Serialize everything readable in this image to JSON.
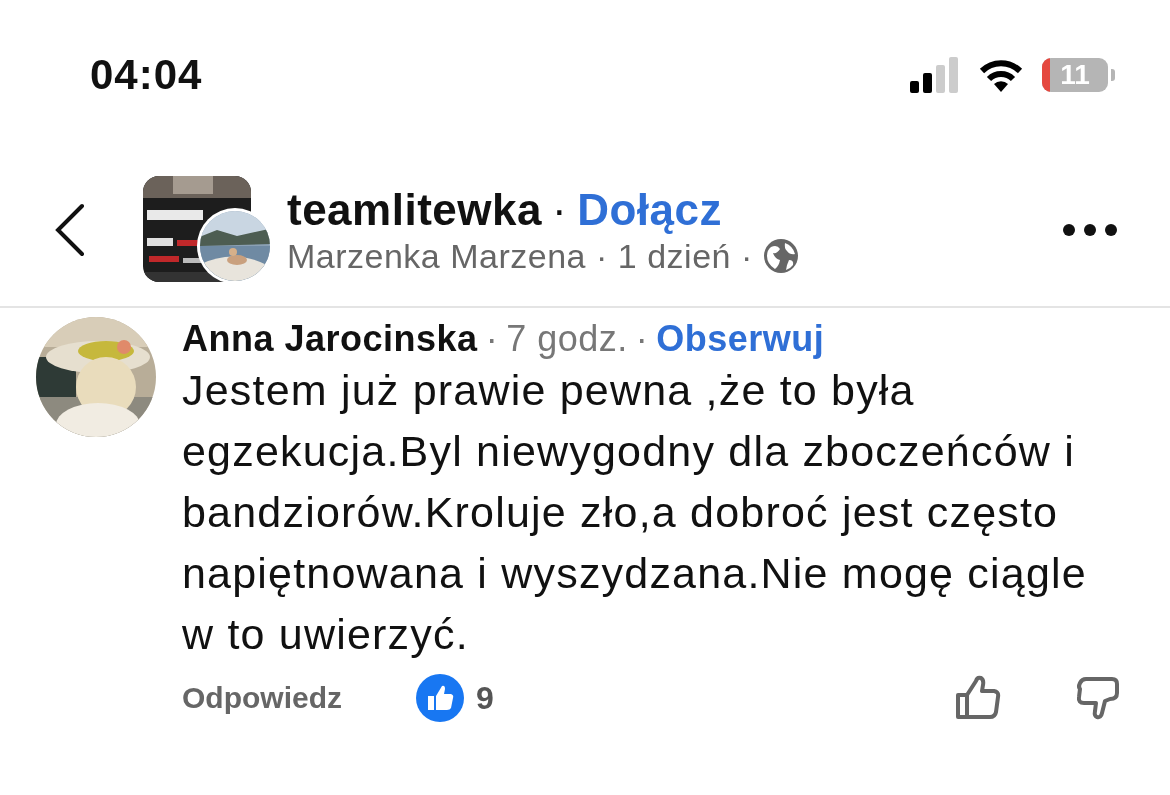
{
  "status_bar": {
    "time": "04:04",
    "battery": "11"
  },
  "post_header": {
    "group": "teamlitewka",
    "separator": "·",
    "join": "Dołącz",
    "author": "Marzenka Marzena",
    "time": "1 dzień"
  },
  "comment": {
    "author": "Anna Jarocinska",
    "time": "7 godz.",
    "follow": "Obserwuj",
    "text": "Jestem już prawie pewna ,że to była egzekucja.Byl niewygodny dla zboczeńców i bandziorów.Kroluje zło,a dobroć jest często napiętnowana i wyszydzana.Nie mogę ciągle w to uwierzyć.",
    "reply": "Odpowiedz",
    "likes": "9"
  }
}
